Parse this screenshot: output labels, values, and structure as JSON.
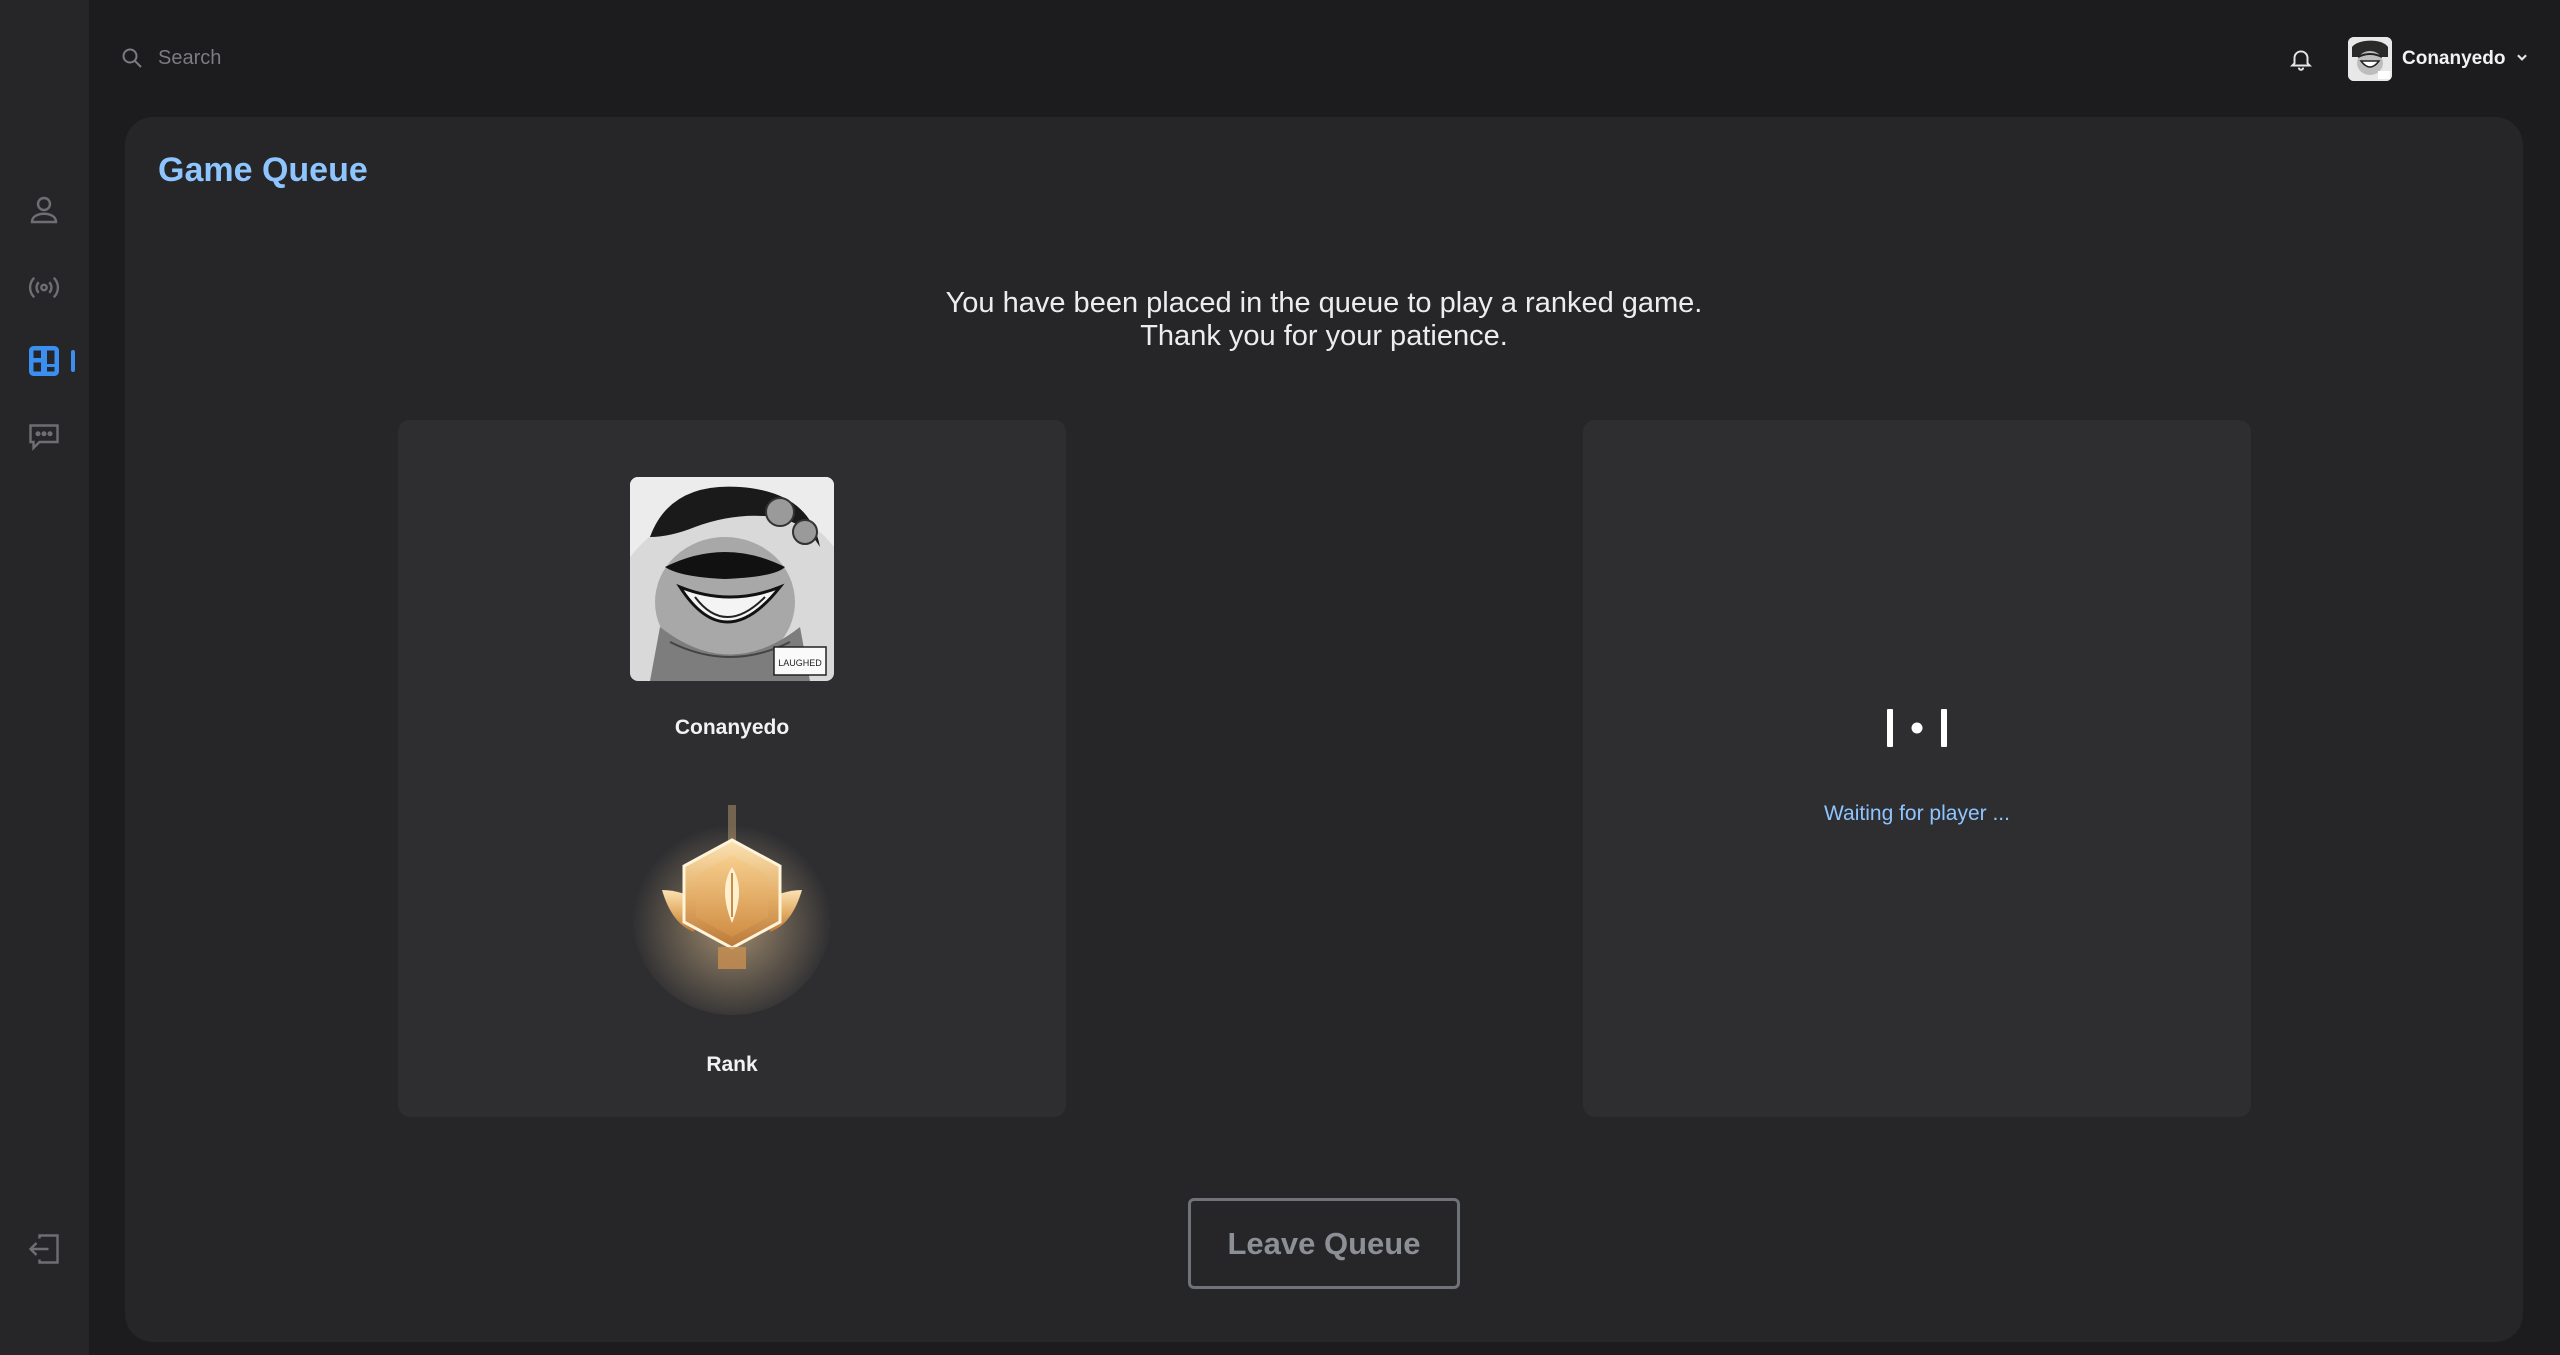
{
  "search": {
    "placeholder": "Search"
  },
  "header": {
    "username": "Conanyedo"
  },
  "sidebar": {
    "items": [
      {
        "name": "profile",
        "icon": "user-icon"
      },
      {
        "name": "live",
        "icon": "broadcast-icon"
      },
      {
        "name": "game",
        "icon": "game-board-icon",
        "active": true
      },
      {
        "name": "chat",
        "icon": "chat-icon"
      }
    ],
    "logout_icon": "logout-icon"
  },
  "main": {
    "title": "Game Queue",
    "message_line1": "You have been placed in the queue to play a ranked game.",
    "message_line2": "Thank you for your patience.",
    "player": {
      "name": "Conanyedo",
      "rank_label": "Rank",
      "avatar_caption": "LAUGHED"
    },
    "opponent": {
      "status": "Waiting for player ..."
    },
    "leave_button": "Leave Queue"
  },
  "colors": {
    "accent": "#3b8ff0",
    "title": "#8ec5ff",
    "background": "#1c1c1e",
    "panel": "#262628",
    "card": "#2e2e31"
  }
}
